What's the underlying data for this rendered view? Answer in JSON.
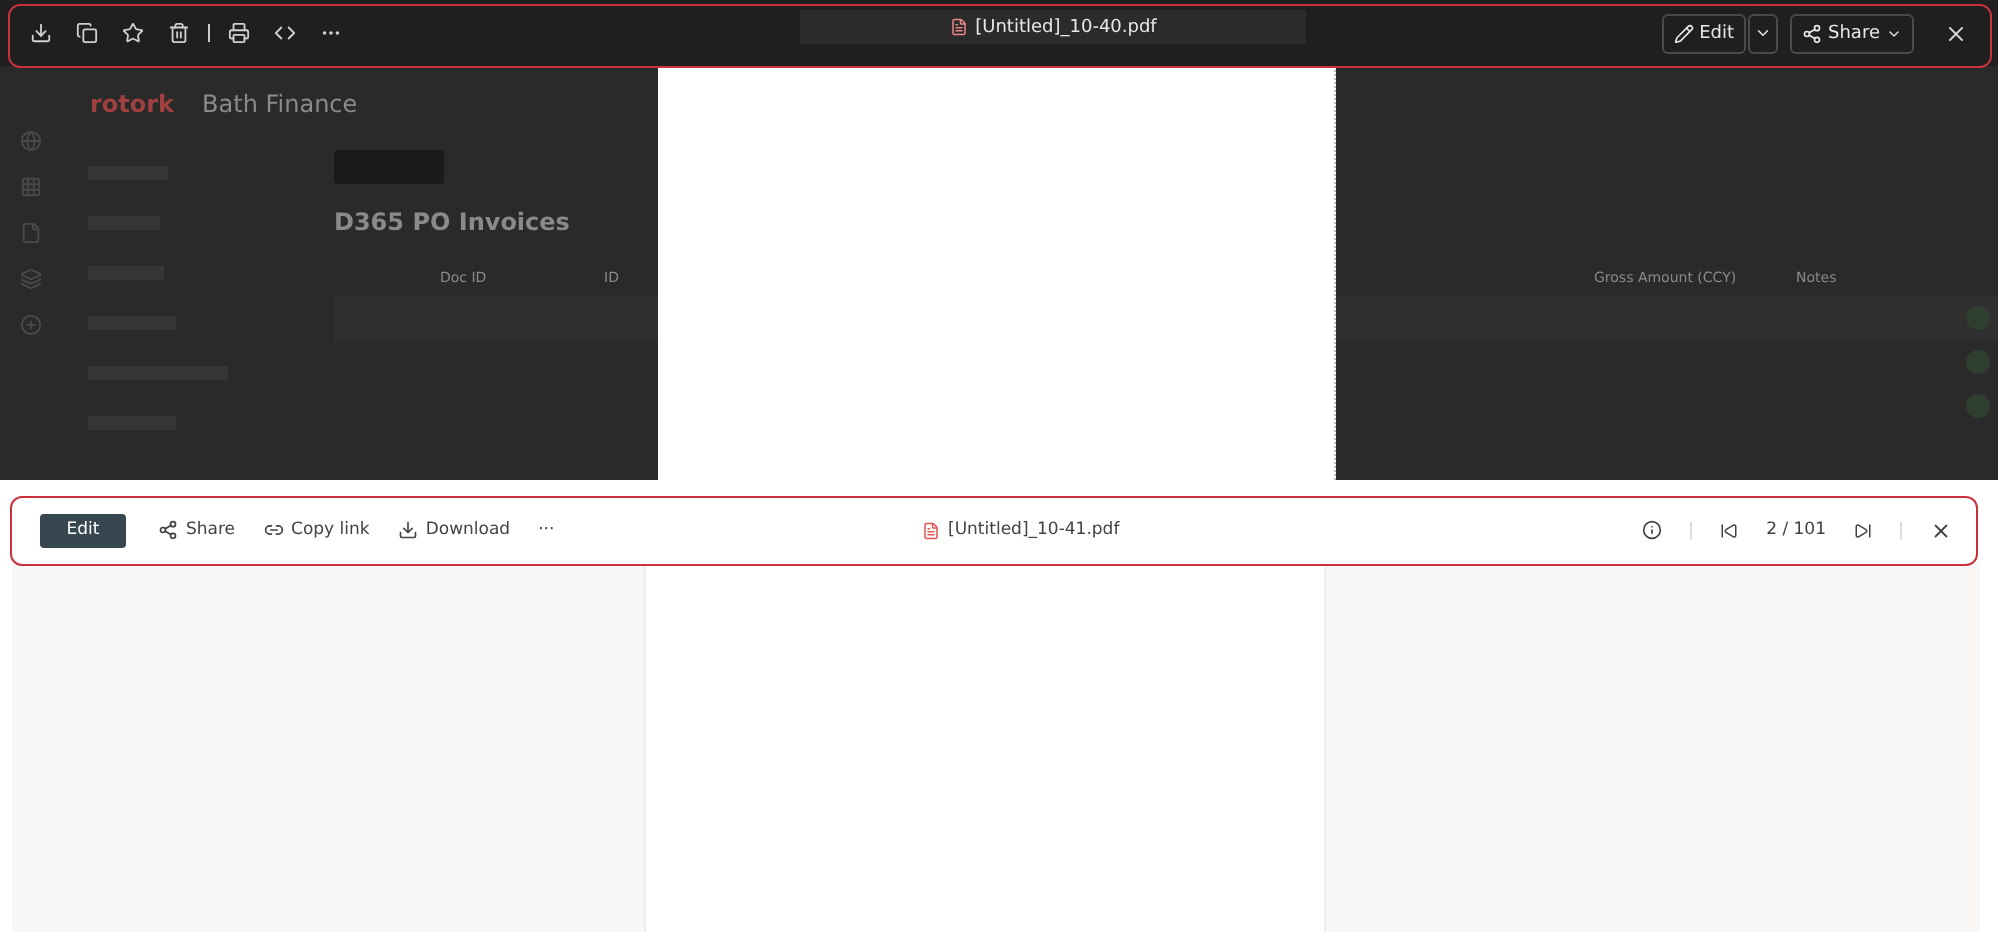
{
  "background_page": {
    "brand": "rotork",
    "site_title": "Bath Finance",
    "library_title": "D365 PO Invoices",
    "columns": [
      {
        "label": "Doc ID"
      },
      {
        "label": "ID"
      },
      {
        "label": "Gross Amount (CCY)"
      },
      {
        "label": "Notes"
      }
    ]
  },
  "dark_viewer": {
    "file_name": "[Untitled]_10-40.pdf",
    "edit_label": "Edit",
    "share_label": "Share"
  },
  "light_viewer": {
    "edit_label": "Edit",
    "actions": [
      {
        "kind": "share",
        "label": "Share"
      },
      {
        "kind": "link",
        "label": "Copy link"
      },
      {
        "kind": "download",
        "label": "Download"
      }
    ],
    "more": "···",
    "file_name": "[Untitled]_10-41.pdf",
    "page_counter": "2 / 101"
  }
}
